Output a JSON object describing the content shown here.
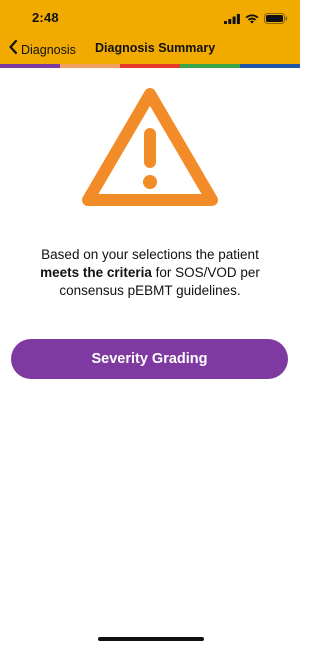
{
  "status_bar": {
    "time": "2:48",
    "icons": [
      "cellular-signal-icon",
      "wifi-icon",
      "battery-icon"
    ]
  },
  "nav": {
    "back_label": "Diagnosis",
    "title": "Diagnosis Summary"
  },
  "color_strip": [
    "#7e3aa0",
    "#f0a063",
    "#e53a2a",
    "#3aa449",
    "#1f56a6"
  ],
  "content": {
    "icon": "warning-triangle-icon",
    "message_before": "Based on your selections the patient ",
    "message_bold": "meets the criteria",
    "message_after": " for SOS/VOD per consensus pEBMT guidelines."
  },
  "actions": {
    "severity_button_label": "Severity Grading"
  },
  "colors": {
    "header_bg": "#f1ab00",
    "warning": "#f28c28",
    "button_bg": "#7e3aa0"
  }
}
